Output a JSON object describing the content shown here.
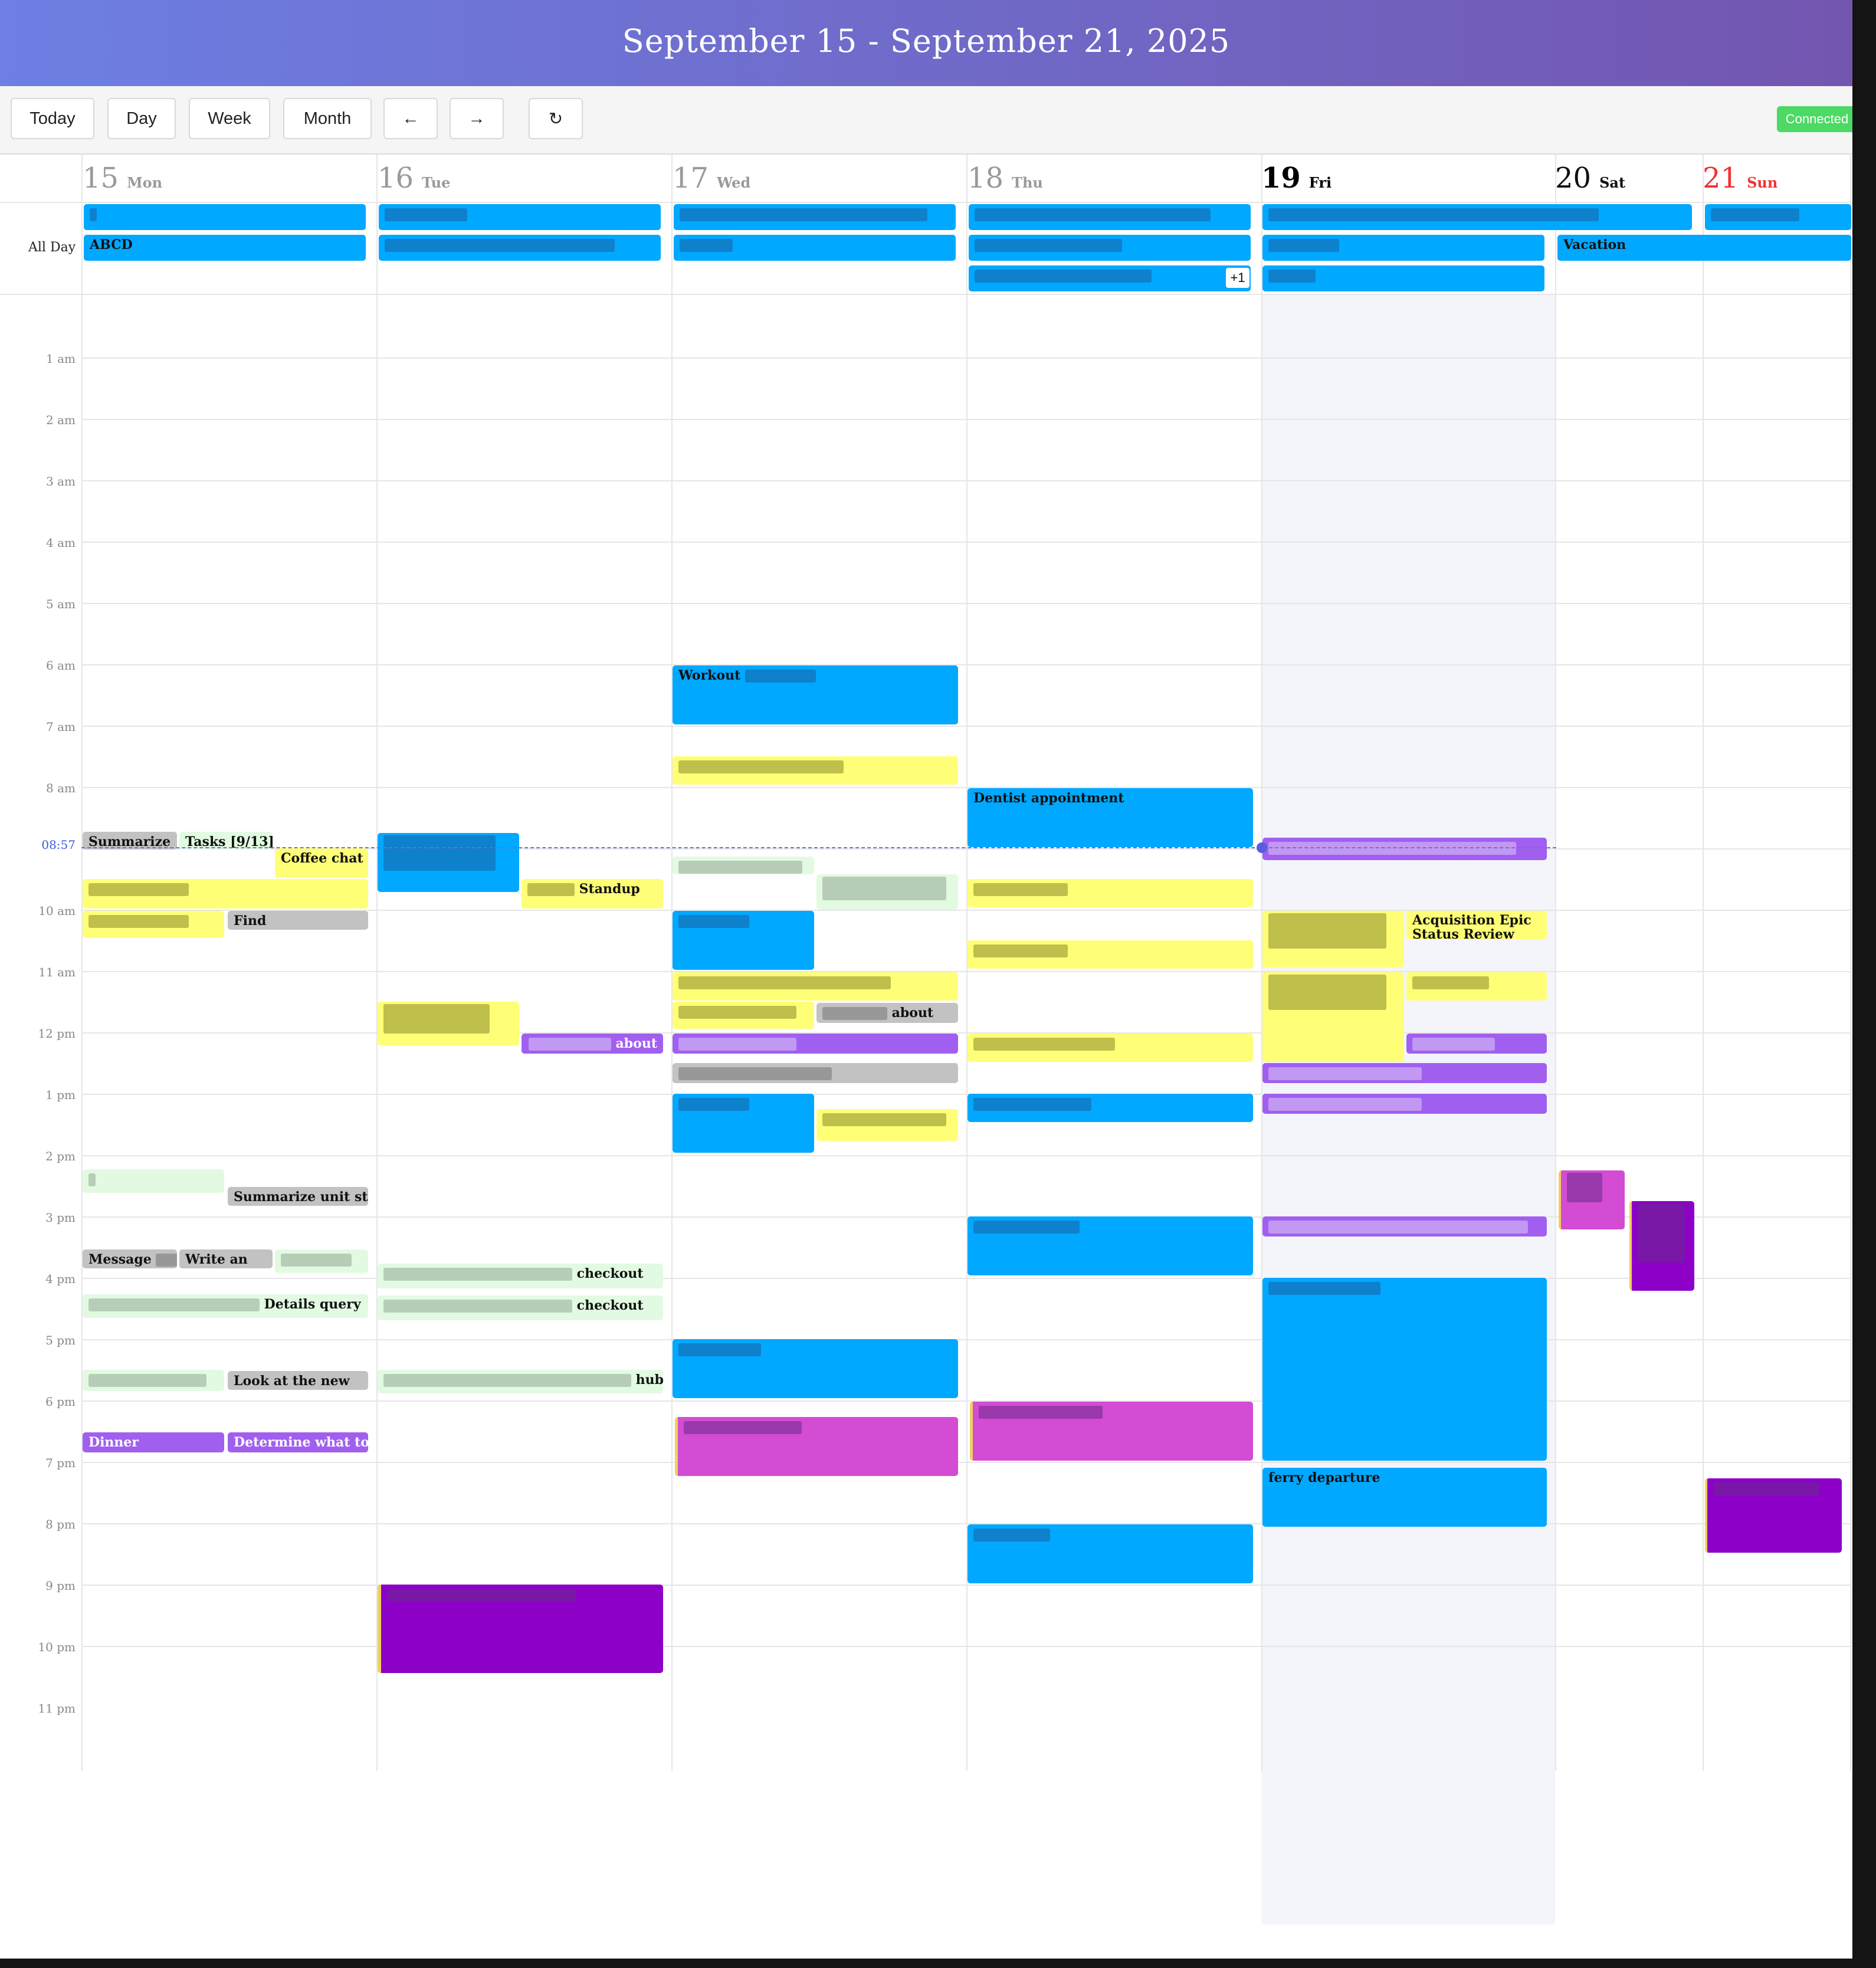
{
  "header": {
    "title": "September 15 - September 21, 2025"
  },
  "toolbar": {
    "today": "Today",
    "day": "Day",
    "week": "Week",
    "month": "Month",
    "prev": "←",
    "next": "→",
    "refresh": "↻",
    "status": "Connected"
  },
  "days": [
    {
      "num": "15",
      "name": "Mon"
    },
    {
      "num": "16",
      "name": "Tue"
    },
    {
      "num": "17",
      "name": "Wed"
    },
    {
      "num": "18",
      "name": "Thu"
    },
    {
      "num": "19",
      "name": "Fri"
    },
    {
      "num": "20",
      "name": "Sat"
    },
    {
      "num": "21",
      "name": "Sun"
    }
  ],
  "allday": {
    "label": "All Day",
    "abcd": "ABCD",
    "vacation": "Vacation",
    "more": "+1"
  },
  "times": [
    "1 am",
    "2 am",
    "3 am",
    "4 am",
    "5 am",
    "6 am",
    "7 am",
    "8 am",
    "10 am",
    "11 am",
    "12 pm",
    "1 pm",
    "2 pm",
    "3 pm",
    "4 pm",
    "5 pm",
    "6 pm",
    "7 pm",
    "8 pm",
    "9 pm",
    "10 pm",
    "11 pm"
  ],
  "now_label": "08:57",
  "events": {
    "mon_summarize": "Summarize",
    "mon_tasks": "Tasks [9/13]",
    "mon_coffee": "Coffee chat",
    "mon_find": "Find",
    "mon_summarize_unit": "Summarize unit strut",
    "mon_message": "Message",
    "mon_write": "Write an",
    "mon_details": "Details query",
    "mon_look": "Look at the new",
    "mon_dinner": "Dinner",
    "mon_determine": "Determine what to do",
    "tue_standup": "Standup",
    "tue_about": "about",
    "tue_checkout1": "checkout",
    "tue_checkout2": "checkout",
    "tue_hub": "hub.",
    "wed_workout": "Workout",
    "wed_about": "about",
    "thu_dentist": "Dentist appointment",
    "fri_acq": "Acquisition Epic Status Review",
    "fri_ferry": "ferry departure"
  },
  "colors": {
    "blue": "#00a8ff",
    "yellow": "#ffff77",
    "gray": "#c2c2c2",
    "violet": "#a15ff0",
    "mint": "#e2fae2",
    "magenta": "#d34cd3",
    "purple": "#8c00c8",
    "connected": "#4cd964",
    "sunday": "#f03333"
  }
}
